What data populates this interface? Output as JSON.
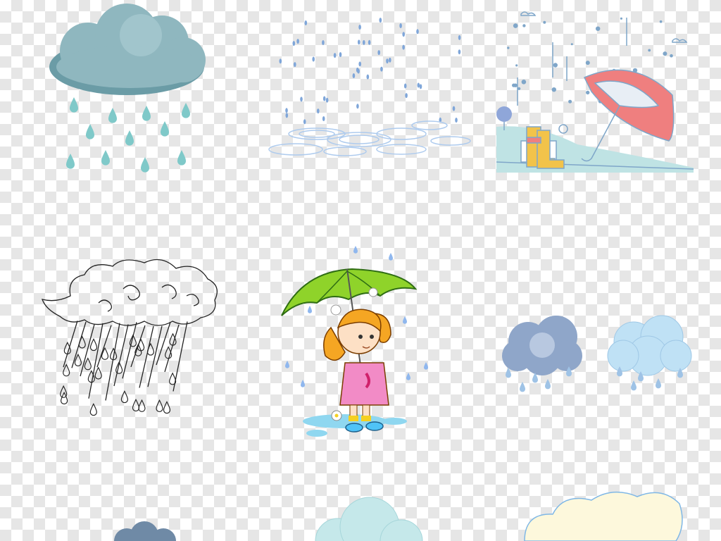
{
  "background": {
    "pattern": "transparency-checkerboard",
    "light": "#ffffff",
    "dark": "#e6e6e6"
  },
  "illustrations": [
    {
      "id": "teal-rain-cloud",
      "kind": "cloud-with-drops",
      "colors": {
        "cloud": "#8fb7bf",
        "cloud_shade": "#6b9ca6",
        "drops": "#7fc9c9"
      }
    },
    {
      "id": "rain-ripples",
      "kind": "rain-puddle-ripples",
      "colors": {
        "drops": "#7fa6d9",
        "ripples": "#aecbee"
      }
    },
    {
      "id": "umbrella-and-boots-scene",
      "kind": "flat-line-scene",
      "colors": {
        "umbrella": "#ef7f7f",
        "boots": "#f2c34a",
        "ground": "#bfe3e4",
        "line": "#7fa6c9"
      }
    },
    {
      "id": "sketch-rain-cloud",
      "kind": "line-art-cloud",
      "colors": {
        "line": "#222222"
      }
    },
    {
      "id": "girl-with-umbrella",
      "kind": "cartoon-character",
      "colors": {
        "umbrella": "#8fd32a",
        "hair": "#f5a623",
        "dress": "#f28bc6",
        "puddle": "#8fd7f0"
      }
    },
    {
      "id": "blue-grey-rain-cloud",
      "kind": "cloud-with-drops",
      "colors": {
        "cloud": "#8fa6c9",
        "drops": "#9fc3e6"
      }
    },
    {
      "id": "light-blue-rain-cloud",
      "kind": "cloud-with-drops",
      "colors": {
        "cloud": "#bfe1f5",
        "drops": "#9fc3e6"
      }
    },
    {
      "id": "navy-cloud-partial",
      "kind": "cloud",
      "colors": {
        "cloud": "#6f8aa6"
      }
    },
    {
      "id": "pale-teal-cloud-partial",
      "kind": "cloud",
      "colors": {
        "cloud": "#c5e8ea"
      }
    },
    {
      "id": "cream-cloud-partial",
      "kind": "cloud",
      "colors": {
        "cloud": "#fdf8dc",
        "outline": "#7fb7e6"
      }
    }
  ]
}
